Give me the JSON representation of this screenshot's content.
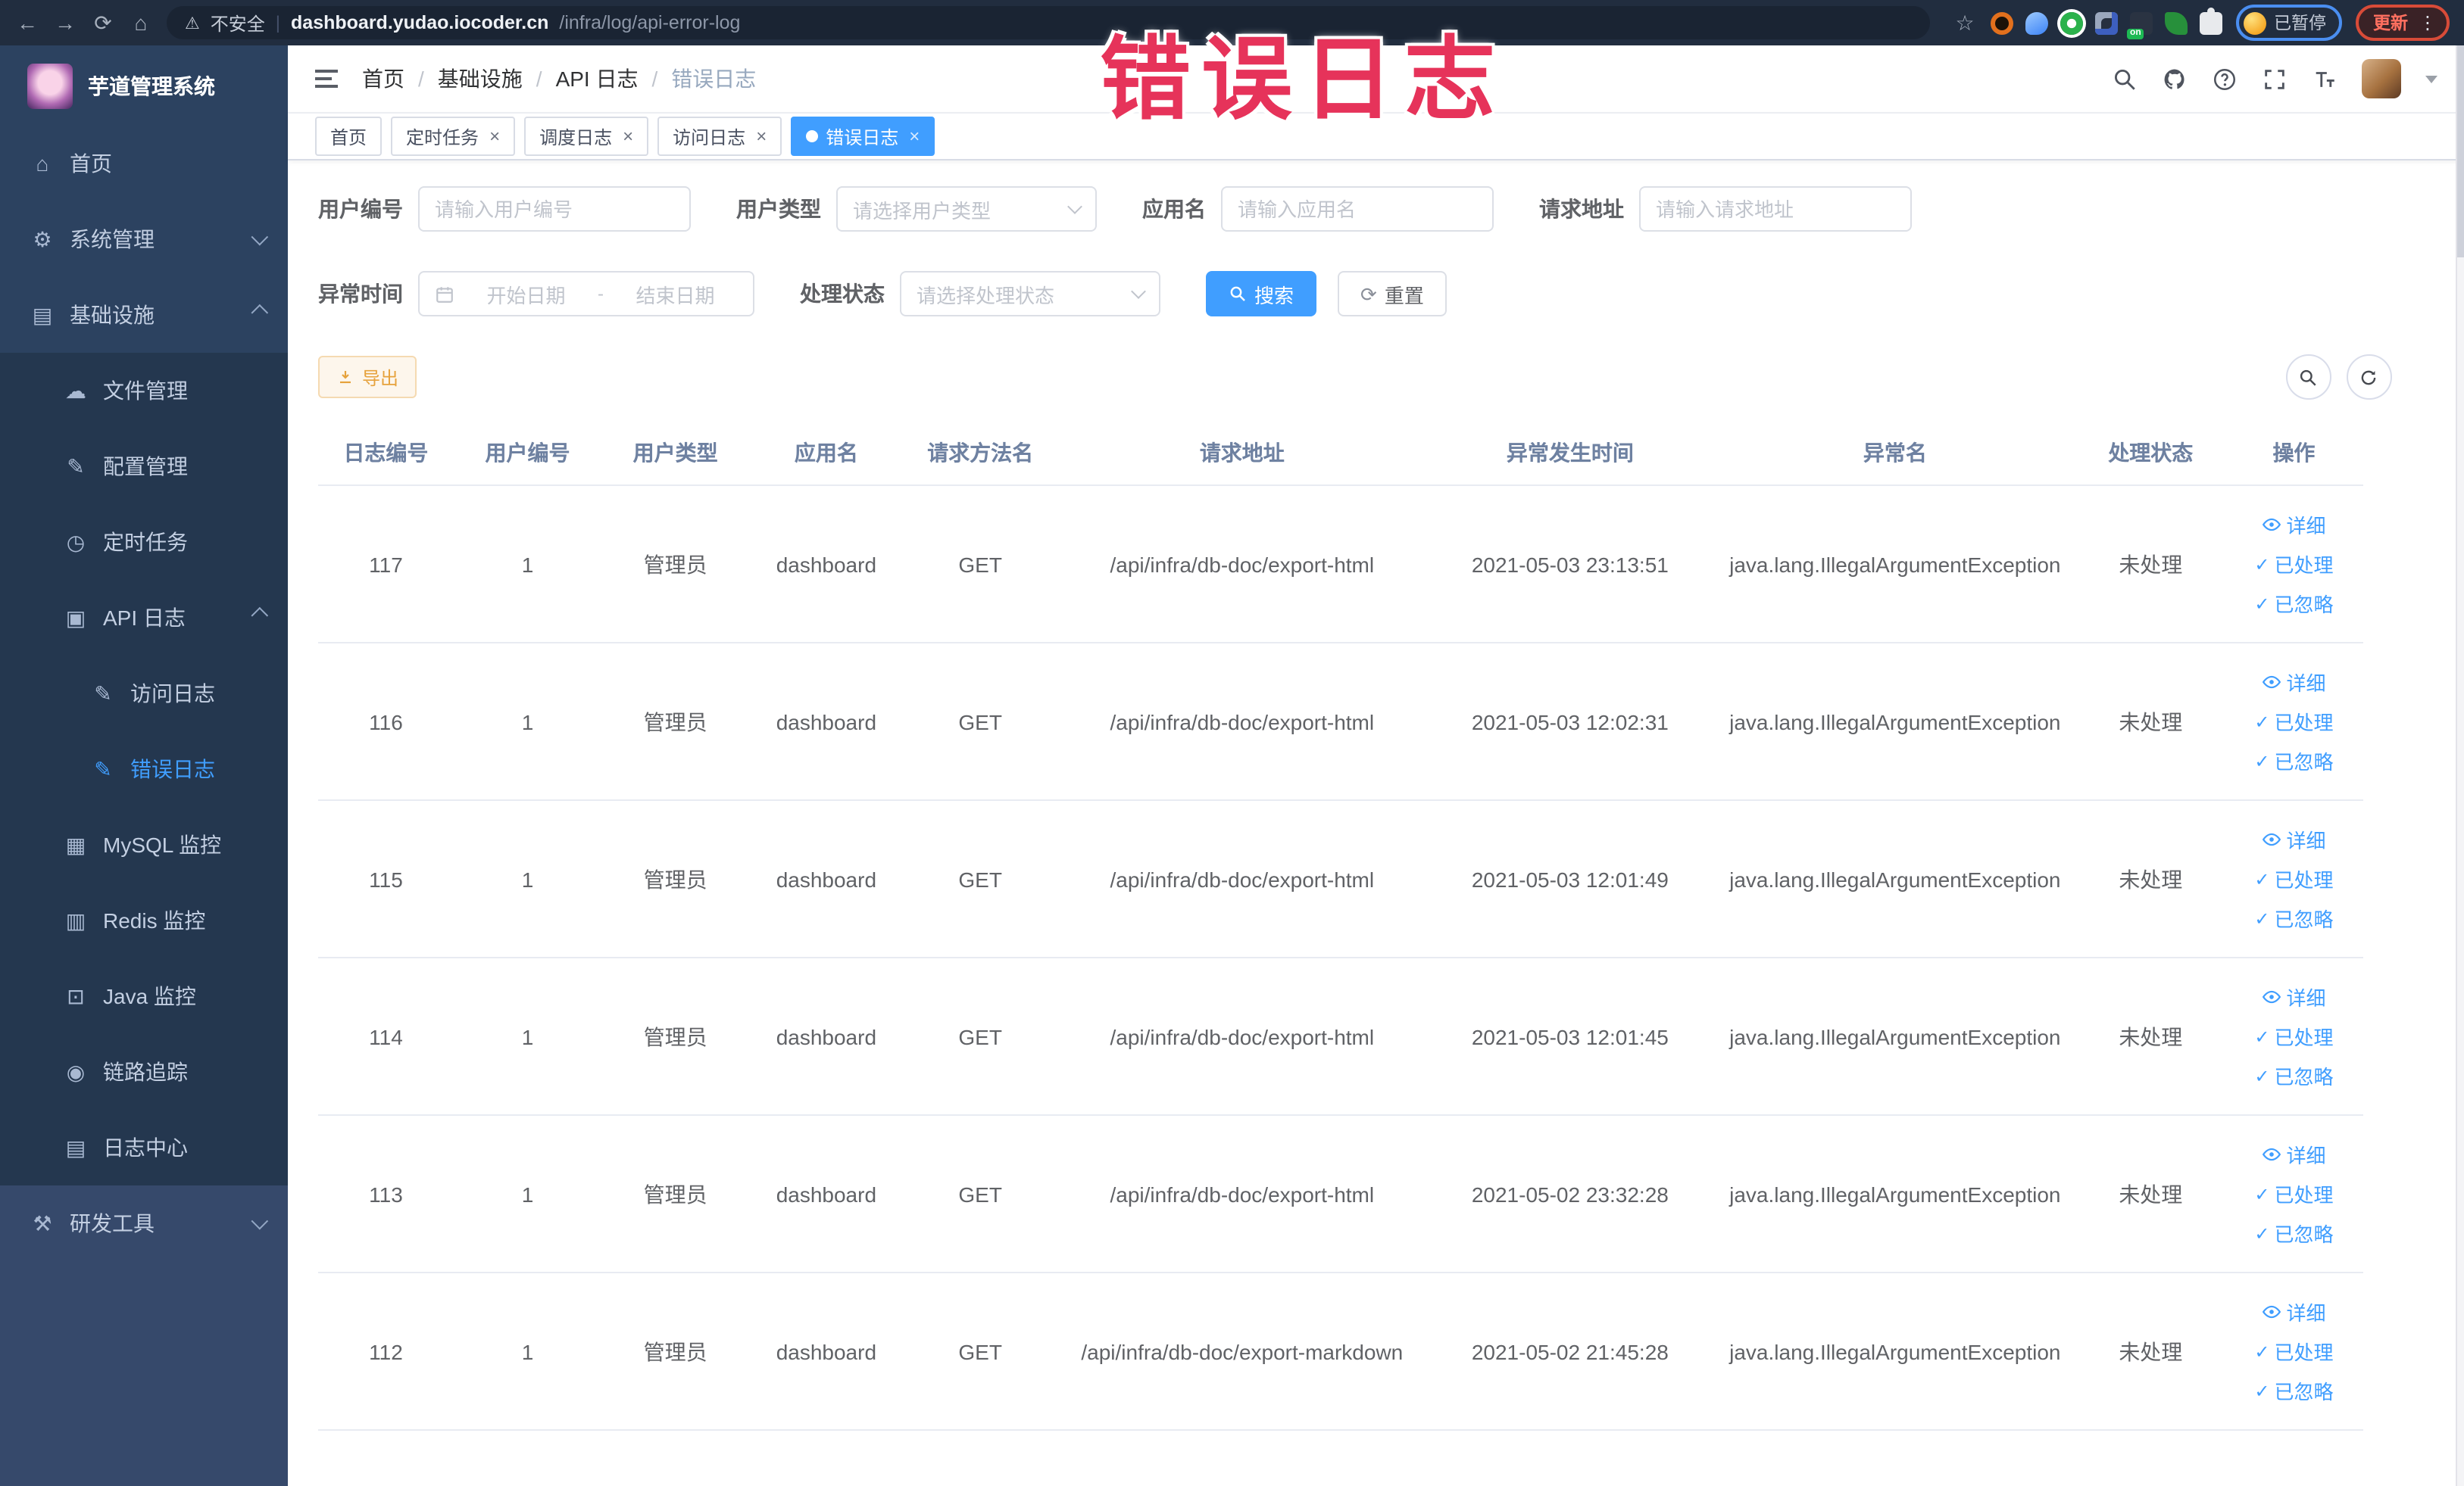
{
  "browser": {
    "security_label": "不安全",
    "url_host": "dashboard.yudao.iocoder.cn",
    "url_path": "/infra/log/api-error-log",
    "paused_badge": "已暂停",
    "update_label": "更新",
    "extensions": [
      {
        "name": "adblock-extension-icon",
        "shape": "ring-orange",
        "badge": ""
      },
      {
        "name": "shield-extension-icon",
        "shape": "drop-blue",
        "badge": ""
      },
      {
        "name": "green-v-extension-icon",
        "shape": "circle-green",
        "badge": ""
      },
      {
        "name": "grid-extension-icon",
        "shape": "grid-dots",
        "badge": ""
      },
      {
        "name": "proxy-extension-icon",
        "shape": "dark-square",
        "badge": "on"
      },
      {
        "name": "leaf-extension-icon",
        "shape": "leaf-green",
        "badge": ""
      },
      {
        "name": "puzzle-extension-icon",
        "shape": "puzzle-white",
        "badge": ""
      }
    ]
  },
  "annotation": "错误日志",
  "sidebar": {
    "title": "芋道管理系统",
    "items": [
      {
        "key": "home",
        "label": "首页",
        "icon": "home-icon",
        "glyph": "⌂",
        "level": 0,
        "section": "top",
        "chevron": "",
        "active": false
      },
      {
        "key": "system-manage",
        "label": "系统管理",
        "icon": "gear-icon",
        "glyph": "⚙",
        "level": 0,
        "section": "top",
        "chevron": "down",
        "active": false
      },
      {
        "key": "infrastructure",
        "label": "基础设施",
        "icon": "infrastructure-icon",
        "glyph": "▤",
        "level": 0,
        "section": "top",
        "chevron": "up",
        "active": false
      },
      {
        "key": "file-manage",
        "label": "文件管理",
        "icon": "cloud-upload-icon",
        "glyph": "☁",
        "level": 1,
        "section": "sub",
        "chevron": "",
        "active": false
      },
      {
        "key": "config-manage",
        "label": "配置管理",
        "icon": "edit-icon",
        "glyph": "✎",
        "level": 1,
        "section": "sub",
        "chevron": "",
        "active": false
      },
      {
        "key": "scheduled-task",
        "label": "定时任务",
        "icon": "timer-icon",
        "glyph": "◷",
        "level": 1,
        "section": "sub",
        "chevron": "",
        "active": false
      },
      {
        "key": "api-log",
        "label": "API 日志",
        "icon": "api-log-icon",
        "glyph": "▣",
        "level": 1,
        "section": "sub",
        "chevron": "up",
        "active": false
      },
      {
        "key": "access-log",
        "label": "访问日志",
        "icon": "access-log-icon",
        "glyph": "✎",
        "level": 2,
        "section": "sub",
        "chevron": "",
        "active": false
      },
      {
        "key": "error-log",
        "label": "错误日志",
        "icon": "error-log-icon",
        "glyph": "✎",
        "level": 2,
        "section": "sub",
        "chevron": "",
        "active": true
      },
      {
        "key": "mysql-monitor",
        "label": "MySQL 监控",
        "icon": "mysql-monitor-icon",
        "glyph": "▦",
        "level": 1,
        "section": "sub",
        "chevron": "",
        "active": false
      },
      {
        "key": "redis-monitor",
        "label": "Redis 监控",
        "icon": "redis-monitor-icon",
        "glyph": "▥",
        "level": 1,
        "section": "sub",
        "chevron": "",
        "active": false
      },
      {
        "key": "java-monitor",
        "label": "Java 监控",
        "icon": "java-monitor-icon",
        "glyph": "⊡",
        "level": 1,
        "section": "sub",
        "chevron": "",
        "active": false
      },
      {
        "key": "tracing",
        "label": "链路追踪",
        "icon": "trace-eye-icon",
        "glyph": "◉",
        "level": 1,
        "section": "sub",
        "chevron": "",
        "active": false
      },
      {
        "key": "log-center",
        "label": "日志中心",
        "icon": "log-center-icon",
        "glyph": "▤",
        "level": 1,
        "section": "sub",
        "chevron": "",
        "active": false
      },
      {
        "key": "dev-tools",
        "label": "研发工具",
        "icon": "dev-tools-icon",
        "glyph": "⚒",
        "level": 0,
        "section": "bottom",
        "chevron": "down",
        "active": false
      }
    ]
  },
  "breadcrumb": [
    "首页",
    "基础设施",
    "API 日志",
    "错误日志"
  ],
  "tabs": [
    {
      "label": "首页",
      "closable": false,
      "active": false
    },
    {
      "label": "定时任务",
      "closable": true,
      "active": false
    },
    {
      "label": "调度日志",
      "closable": true,
      "active": false
    },
    {
      "label": "访问日志",
      "closable": true,
      "active": false
    },
    {
      "label": "错误日志",
      "closable": true,
      "active": true
    }
  ],
  "filters": {
    "user_id": {
      "label": "用户编号",
      "placeholder": "请输入用户编号"
    },
    "user_type": {
      "label": "用户类型",
      "placeholder": "请选择用户类型"
    },
    "app_name": {
      "label": "应用名",
      "placeholder": "请输入应用名"
    },
    "request_url": {
      "label": "请求地址",
      "placeholder": "请输入请求地址"
    },
    "exception_time": {
      "label": "异常时间",
      "start_placeholder": "开始日期",
      "separator": "-",
      "end_placeholder": "结束日期"
    },
    "process_status": {
      "label": "处理状态",
      "placeholder": "请选择处理状态"
    },
    "search_button": "搜索",
    "reset_button": "重置"
  },
  "toolbar": {
    "export_button": "导出"
  },
  "table": {
    "columns": [
      "日志编号",
      "用户编号",
      "用户类型",
      "应用名",
      "请求方法名",
      "请求地址",
      "异常发生时间",
      "异常名",
      "处理状态",
      "操作"
    ],
    "actions": [
      "详细",
      "已处理",
      "已忽略"
    ],
    "rows": [
      {
        "log_id": "117",
        "user_id": "1",
        "user_type": "管理员",
        "app_name": "dashboard",
        "method": "GET",
        "url": "/api/infra/db-doc/export-html",
        "time": "2021-05-03 23:13:51",
        "exception": "java.lang.IllegalArgumentException",
        "status": "未处理"
      },
      {
        "log_id": "116",
        "user_id": "1",
        "user_type": "管理员",
        "app_name": "dashboard",
        "method": "GET",
        "url": "/api/infra/db-doc/export-html",
        "time": "2021-05-03 12:02:31",
        "exception": "java.lang.IllegalArgumentException",
        "status": "未处理"
      },
      {
        "log_id": "115",
        "user_id": "1",
        "user_type": "管理员",
        "app_name": "dashboard",
        "method": "GET",
        "url": "/api/infra/db-doc/export-html",
        "time": "2021-05-03 12:01:49",
        "exception": "java.lang.IllegalArgumentException",
        "status": "未处理"
      },
      {
        "log_id": "114",
        "user_id": "1",
        "user_type": "管理员",
        "app_name": "dashboard",
        "method": "GET",
        "url": "/api/infra/db-doc/export-html",
        "time": "2021-05-03 12:01:45",
        "exception": "java.lang.IllegalArgumentException",
        "status": "未处理"
      },
      {
        "log_id": "113",
        "user_id": "1",
        "user_type": "管理员",
        "app_name": "dashboard",
        "method": "GET",
        "url": "/api/infra/db-doc/export-html",
        "time": "2021-05-02 23:32:28",
        "exception": "java.lang.IllegalArgumentException",
        "status": "未处理"
      },
      {
        "log_id": "112",
        "user_id": "1",
        "user_type": "管理员",
        "app_name": "dashboard",
        "method": "GET",
        "url": "/api/infra/db-doc/export-markdown",
        "time": "2021-05-02 21:45:28",
        "exception": "java.lang.IllegalArgumentException",
        "status": "未处理"
      }
    ]
  },
  "colors": {
    "accent": "#409eff",
    "warning": "#e6a23c",
    "annotation_red": "#e6335a",
    "sidebar_base": "#2c4260",
    "sidebar_submenu": "#24374f",
    "sidebar_bottom": "#36496b",
    "browser_bar": "#212d3f"
  }
}
